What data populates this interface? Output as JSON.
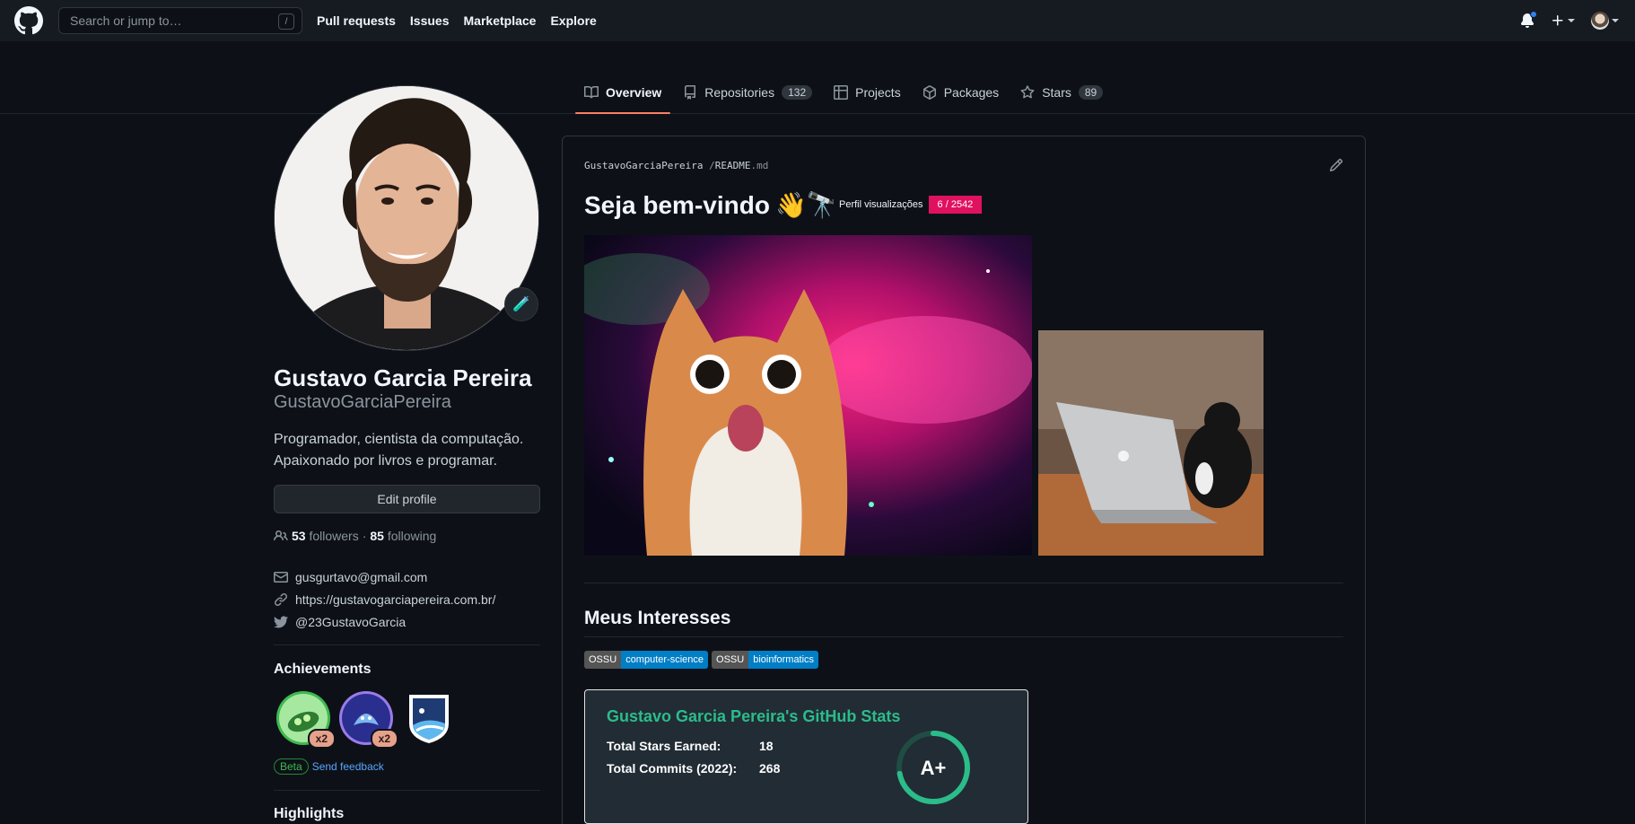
{
  "header": {
    "search_placeholder": "Search or jump to…",
    "search_key": "/",
    "nav": [
      "Pull requests",
      "Issues",
      "Marketplace",
      "Explore"
    ]
  },
  "tabs": [
    {
      "label": "Overview",
      "icon": "book-icon",
      "active": true
    },
    {
      "label": "Repositories",
      "icon": "repo-icon",
      "count": "132"
    },
    {
      "label": "Projects",
      "icon": "table-icon"
    },
    {
      "label": "Packages",
      "icon": "package-icon"
    },
    {
      "label": "Stars",
      "icon": "star-icon",
      "count": "89"
    }
  ],
  "profile": {
    "full_name": "Gustavo Garcia Pereira",
    "login": "GustavoGarciaPereira",
    "bio": "Programador, cientista da computação. Apaixonado por livros e programar.",
    "edit_label": "Edit profile",
    "followers": "53",
    "followers_label": "followers",
    "following": "85",
    "following_label": "following",
    "separator": "·",
    "email": "gusgurtavo@gmail.com",
    "website": "https://gustavogarciapereira.com.br/",
    "twitter": "@23GustavoGarcia",
    "status_emoji": "🧪"
  },
  "achievements": {
    "title": "Achievements",
    "badges": [
      {
        "name": "pair-extraordinaire",
        "multiplier": "x2"
      },
      {
        "name": "quickdraw-shark",
        "multiplier": "x2"
      },
      {
        "name": "arctic-code-vault"
      }
    ],
    "beta": "Beta",
    "feedback": "Send feedback"
  },
  "highlights_title": "Highlights",
  "readme": {
    "owner": "GustavoGarciaPereira",
    "sep": "/",
    "file": "README",
    "ext": ".md",
    "heading": "Seja bem-vindo",
    "heading_emoji": "👋🔭",
    "views_label": "Perfil visualizações",
    "views_value": "6 / 2542",
    "section_title": "Meus Interesses",
    "shields": [
      {
        "key": "OSSU",
        "value": "computer-science"
      },
      {
        "key": "OSSU",
        "value": "bioinformatics"
      }
    ],
    "stats": {
      "title": "Gustavo Garcia Pereira's GitHub Stats",
      "rows": [
        {
          "label": "Total Stars Earned:",
          "value": "18"
        },
        {
          "label": "Total Commits (2022):",
          "value": "268"
        }
      ],
      "rank": "A+",
      "rank_progress": 0.72,
      "title_color": "#2bbc8a"
    }
  },
  "colors": {
    "background": "#0d1117",
    "header": "#161b22",
    "tab_underline": "#f78166",
    "link": "#58a6ff",
    "views_badge": "#e0115f"
  }
}
